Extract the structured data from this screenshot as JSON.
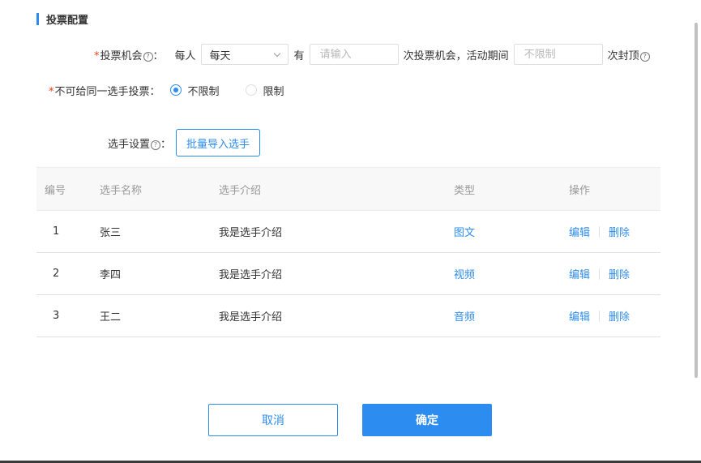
{
  "section": {
    "title": "投票配置"
  },
  "vote_chance": {
    "label": "投票机会",
    "per_person": "每人",
    "period_value": "每天",
    "has": "有",
    "count_placeholder": "请输入",
    "mid_text": "次投票机会，活动期间",
    "cap_placeholder": "不限制",
    "suffix": "次封顶"
  },
  "same_player": {
    "label": "不可给同一选手投票：",
    "options": [
      "不限制",
      "限制"
    ],
    "selected": "不限制"
  },
  "player_settings": {
    "label": "选手设置",
    "import_button": "批量导入选手"
  },
  "table": {
    "headers": [
      "编号",
      "选手名称",
      "选手介绍",
      "类型",
      "操作"
    ],
    "rows": [
      {
        "id": "1",
        "name": "张三",
        "intro": "我是选手介绍",
        "type": "图文",
        "edit": "编辑",
        "delete": "删除"
      },
      {
        "id": "2",
        "name": "李四",
        "intro": "我是选手介绍",
        "type": "视频",
        "edit": "编辑",
        "delete": "删除"
      },
      {
        "id": "3",
        "name": "王二",
        "intro": "我是选手介绍",
        "type": "音频",
        "edit": "编辑",
        "delete": "删除"
      }
    ]
  },
  "footer": {
    "cancel": "取消",
    "confirm": "确定"
  },
  "colors": {
    "accent": "#2d8cf0",
    "required": "#ed4014"
  }
}
